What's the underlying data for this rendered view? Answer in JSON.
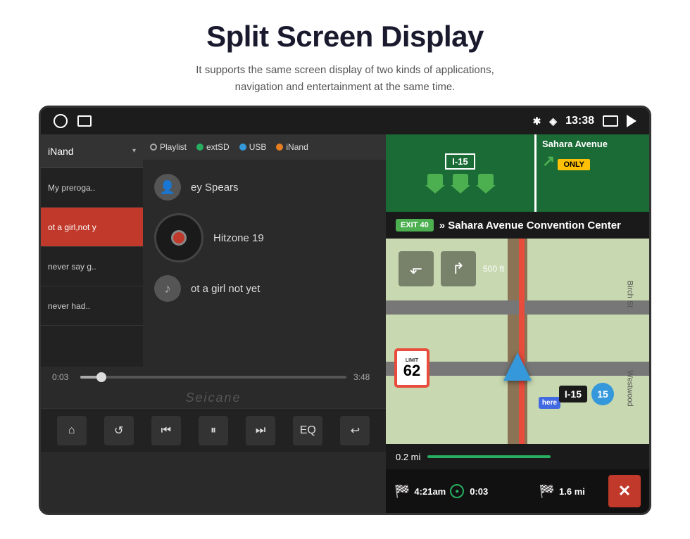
{
  "header": {
    "title": "Split Screen Display",
    "subtitle_line1": "It supports the same screen display of two kinds of applications,",
    "subtitle_line2": "navigation and entertainment at the same time."
  },
  "status_bar": {
    "time": "13:38"
  },
  "music": {
    "source_options": [
      "Playlist",
      "extSD",
      "USB",
      "iNand"
    ],
    "selected_source": "iNand",
    "playlist": [
      {
        "text": "My preroga..",
        "active": false
      },
      {
        "text": "ot a girl,not y",
        "active": true
      },
      {
        "text": "never say g..",
        "active": false
      },
      {
        "text": "never had..",
        "active": false
      }
    ],
    "artist": "ey Spears",
    "album": "Hitzone 19",
    "track": "ot a girl not yet",
    "time_elapsed": "0:03",
    "time_total": "3:48",
    "watermark": "Seicane",
    "controls": {
      "home": "⌂",
      "repeat": "↺",
      "prev": "⏮",
      "pause": "⏸",
      "next": "⏭",
      "eq": "EQ",
      "back": "↩"
    }
  },
  "navigation": {
    "highway_number": "I-15",
    "sahara_avenue": "Sahara Avenue",
    "only_label": "ONLY",
    "exit_badge": "EXIT 40",
    "route_text": "» Sahara Avenue Convention Center",
    "speed_limit_label": "LIMIT",
    "speed_limit": "62",
    "highway_shield": "I-15",
    "road_birch": "Birch St",
    "road_west": "Westwood",
    "eta": "4:21am",
    "elapsed": "0:03",
    "distance": "1.6 mi",
    "dist_label": "0.2 mi"
  }
}
